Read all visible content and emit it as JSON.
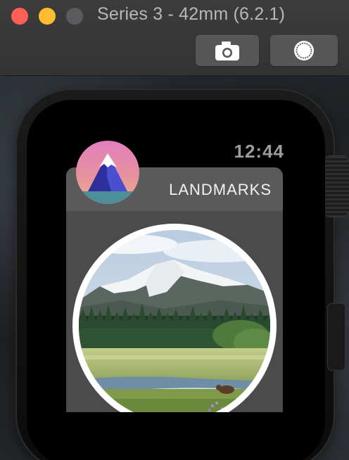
{
  "window": {
    "title": "Series 3 - 42mm (6.2.1)",
    "buttons": [
      {
        "name": "screenshot",
        "icon": "camera-icon"
      },
      {
        "name": "home",
        "icon": "home-button-icon"
      }
    ]
  },
  "watch": {
    "time": "12:44",
    "app": {
      "title": "LANDMARKS",
      "icon": "landmarks-app-icon",
      "image": "landmark-photo"
    }
  },
  "colors": {
    "close": "#fe5f57",
    "minimize": "#febc2e",
    "zoom_disabled": "#5b5b5e",
    "card_header": "#5a5a5a",
    "card_body": "#4b4b4b"
  }
}
